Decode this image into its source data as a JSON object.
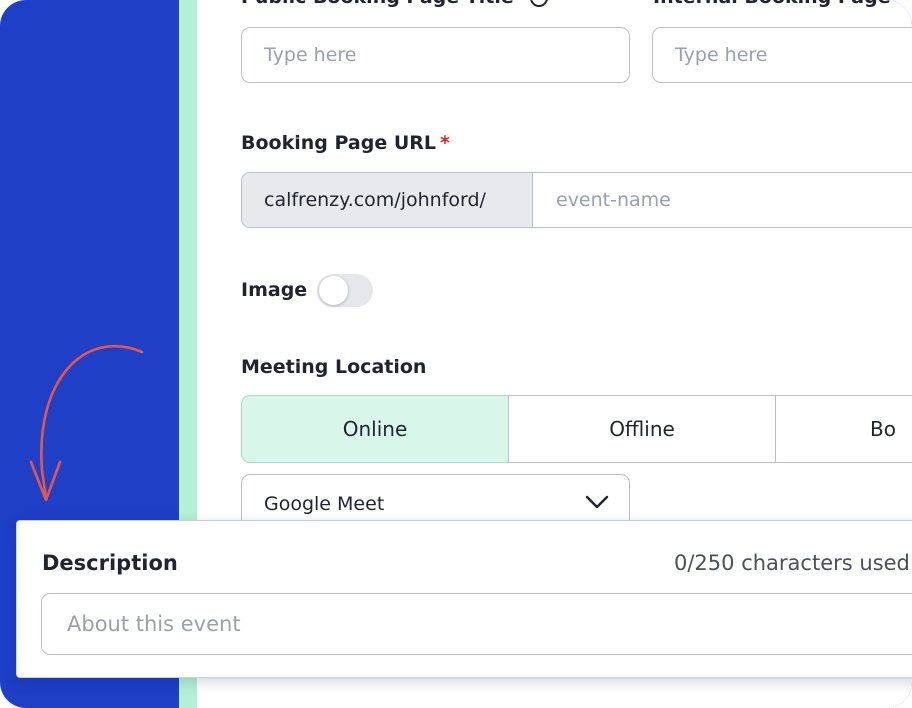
{
  "colors": {
    "background_blue": "#1e3fc6",
    "accent_mint": "#b4f0d3",
    "active_segment": "#d9f6ea",
    "required_star": "#e02424",
    "arrow": "#e4574c"
  },
  "header": {
    "public_title_label": "Public Booking Page Title",
    "internal_title_label": "Internal Booking Page N",
    "public_title_placeholder": "Type here",
    "internal_title_placeholder": "Type here",
    "info_icon": "info-circle-icon"
  },
  "booking_url": {
    "label": "Booking Page URL",
    "required_mark": "*",
    "prefix": "calfrenzy.com/johnford/",
    "placeholder": "event-name"
  },
  "image": {
    "label": "Image",
    "toggle_on": false
  },
  "meeting_location": {
    "label": "Meeting Location",
    "options": [
      "Online",
      "Offline",
      "Bo"
    ],
    "selected": "Online",
    "provider": "Google Meet",
    "chevron_icon": "chevron-down-icon"
  },
  "description": {
    "label": "Description",
    "counter": "0/250 characters used",
    "placeholder": "About this event"
  },
  "decoration": {
    "arrow_icon": "curved-arrow-icon"
  }
}
